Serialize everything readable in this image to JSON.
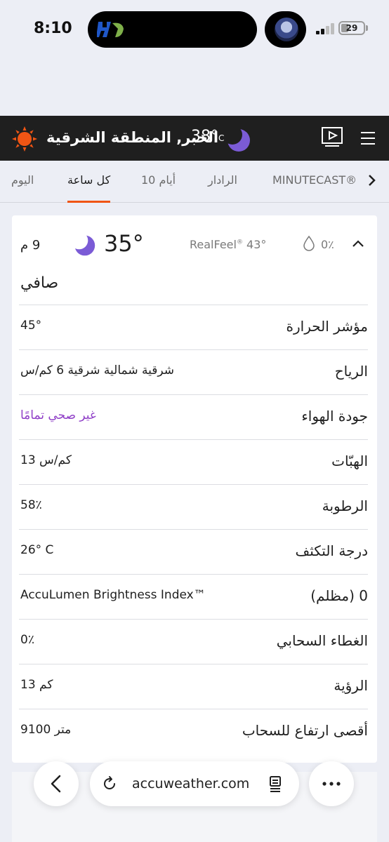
{
  "status_bar": {
    "time": "8:10",
    "battery": "29"
  },
  "header": {
    "location": "الخبر, المنطقة الشرقية",
    "temperature": "38°",
    "unit": "C"
  },
  "tabs": [
    {
      "label": "اليوم"
    },
    {
      "label": "كل ساعة"
    },
    {
      "label": "أيام 10"
    },
    {
      "label": "الرادار"
    },
    {
      "label": "MINUTECAST®"
    }
  ],
  "hourly": {
    "hour": "9 م",
    "temperature": "35°",
    "realfeel_label": "RealFeel",
    "realfeel_mark": "®",
    "realfeel_value": "43°",
    "precip": "0٪",
    "phrase": "صافي",
    "details": [
      {
        "label": "مؤشر الحرارة",
        "value": "45°"
      },
      {
        "label": "الرياح",
        "value": "شرقية شمالية شرقية 6 كم/س"
      },
      {
        "label": "جودة الهواء",
        "value": "غير صحي تمامًا",
        "color": "#8f3ec7"
      },
      {
        "label": "الهبّات",
        "value": "13 كم/س"
      },
      {
        "label": "الرطوبة",
        "value": "58٪"
      },
      {
        "label": "درجة التكثف",
        "value": "26° C"
      },
      {
        "label": "AccuLumen Brightness Index™",
        "value": "0 (مظلم)"
      },
      {
        "label": "الغطاء السحابي",
        "value": "0٪"
      },
      {
        "label": "الرؤية",
        "value": "13 كم"
      },
      {
        "label": "أقصى ارتفاع للسحاب",
        "value": "9100 متر"
      }
    ]
  },
  "browser": {
    "url": "accuweather.com"
  },
  "colors": {
    "accent": "#f05514",
    "moon": "#7b5bd6",
    "air_quality": "#8f3ec7",
    "header_bg": "#1f1f1f"
  },
  "icons": [
    "hilal-logo-icon",
    "avatar-icon",
    "signal-icon",
    "battery-icon",
    "accuweather-sun-icon",
    "moon-icon",
    "video-icon",
    "menu-icon",
    "chevron-right-icon",
    "raindrop-icon",
    "chevron-up-icon",
    "back-icon",
    "reload-icon",
    "reader-icon",
    "more-icon"
  ]
}
